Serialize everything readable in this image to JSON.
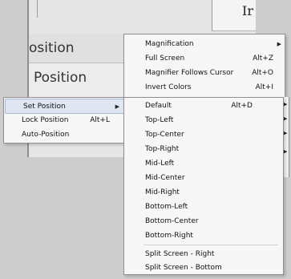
{
  "background": {
    "partial_text_1": "osition",
    "partial_text_2": "Position",
    "partial_text_right": "Ir"
  },
  "top_menu": {
    "items": [
      {
        "label": "Magnification",
        "shortcut": "",
        "has_submenu": true
      },
      {
        "label": "Full Screen",
        "shortcut": "Alt+Z",
        "has_submenu": false
      },
      {
        "label": "Magnifier Follows Cursor",
        "shortcut": "Alt+O",
        "has_submenu": false
      },
      {
        "label": "Invert Colors",
        "shortcut": "Alt+I",
        "has_submenu": false
      }
    ]
  },
  "left_menu": {
    "items": [
      {
        "label": "Set Position",
        "shortcut": "",
        "has_submenu": true,
        "highlighted": true
      },
      {
        "label": "Lock Position",
        "shortcut": "Alt+L",
        "has_submenu": false
      },
      {
        "label": "Auto-Position",
        "shortcut": "",
        "has_submenu": false
      }
    ]
  },
  "position_menu": {
    "items": [
      {
        "label": "Default",
        "shortcut": "Alt+D"
      },
      {
        "label": "Top-Left",
        "shortcut": ""
      },
      {
        "label": "Top-Center",
        "shortcut": ""
      },
      {
        "label": "Top-Right",
        "shortcut": ""
      },
      {
        "label": "Mid-Left",
        "shortcut": ""
      },
      {
        "label": "Mid-Center",
        "shortcut": ""
      },
      {
        "label": "Mid-Right",
        "shortcut": ""
      },
      {
        "label": "Bottom-Left",
        "shortcut": ""
      },
      {
        "label": "Bottom-Center",
        "shortcut": ""
      },
      {
        "label": "Bottom-Right",
        "shortcut": ""
      },
      {
        "label": "Split Screen - Right",
        "shortcut": ""
      },
      {
        "label": "Split Screen - Bottom",
        "shortcut": ""
      }
    ]
  },
  "glyphs": {
    "submenu_arrow": "▶"
  },
  "colors": {
    "highlight": "#dfe6f1",
    "menu_bg": "#f7f7f7"
  }
}
